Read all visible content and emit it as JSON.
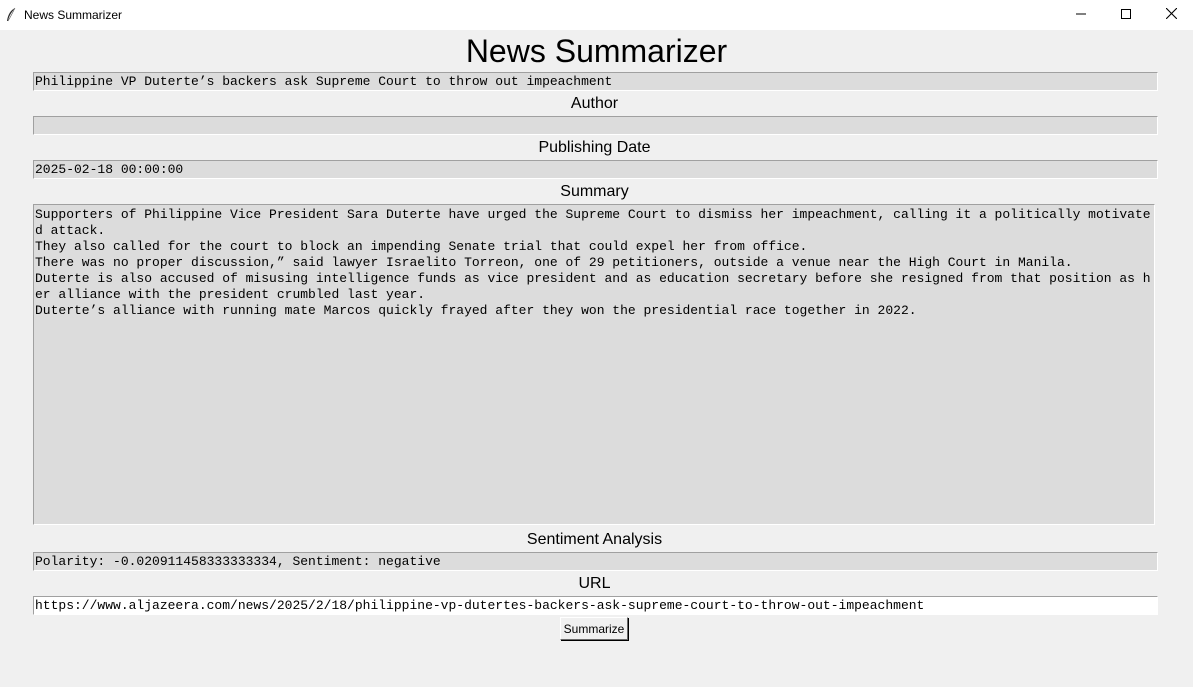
{
  "window": {
    "title": "News Summarizer"
  },
  "heading": "News Summarizer",
  "article_title": "Philippine VP Duterte’s backers ask Supreme Court to throw out impeachment",
  "author": {
    "label": "Author",
    "value": ""
  },
  "publishing_date": {
    "label": "Publishing Date",
    "value": "2025-02-18 00:00:00"
  },
  "summary": {
    "label": "Summary",
    "lines": [
      "Supporters of Philippine Vice President Sara Duterte have urged the Supreme Court to dismiss her impeachment, calling it a politically motivated attack.",
      "They also called for the court to block an impending Senate trial that could expel her from office.",
      "There was no proper discussion,” said lawyer Israelito Torreon, one of 29 petitioners, outside a venue near the High Court in Manila.",
      "Duterte is also accused of misusing intelligence funds as vice president and as education secretary before she resigned from that position as her alliance with the president crumbled last year.",
      "Duterte’s alliance with running mate Marcos quickly frayed after they won the presidential race together in 2022."
    ]
  },
  "sentiment": {
    "label": "Sentiment Analysis",
    "value": "Polarity: -0.020911458333333334, Sentiment: negative"
  },
  "url": {
    "label": "URL",
    "value": "https://www.aljazeera.com/news/2025/2/18/philippine-vp-dutertes-backers-ask-supreme-court-to-throw-out-impeachment"
  },
  "buttons": {
    "summarize": "Summarize"
  },
  "icons": {
    "app": "feather-icon",
    "minimize": "minimize-icon",
    "maximize": "maximize-icon",
    "close": "close-icon"
  }
}
